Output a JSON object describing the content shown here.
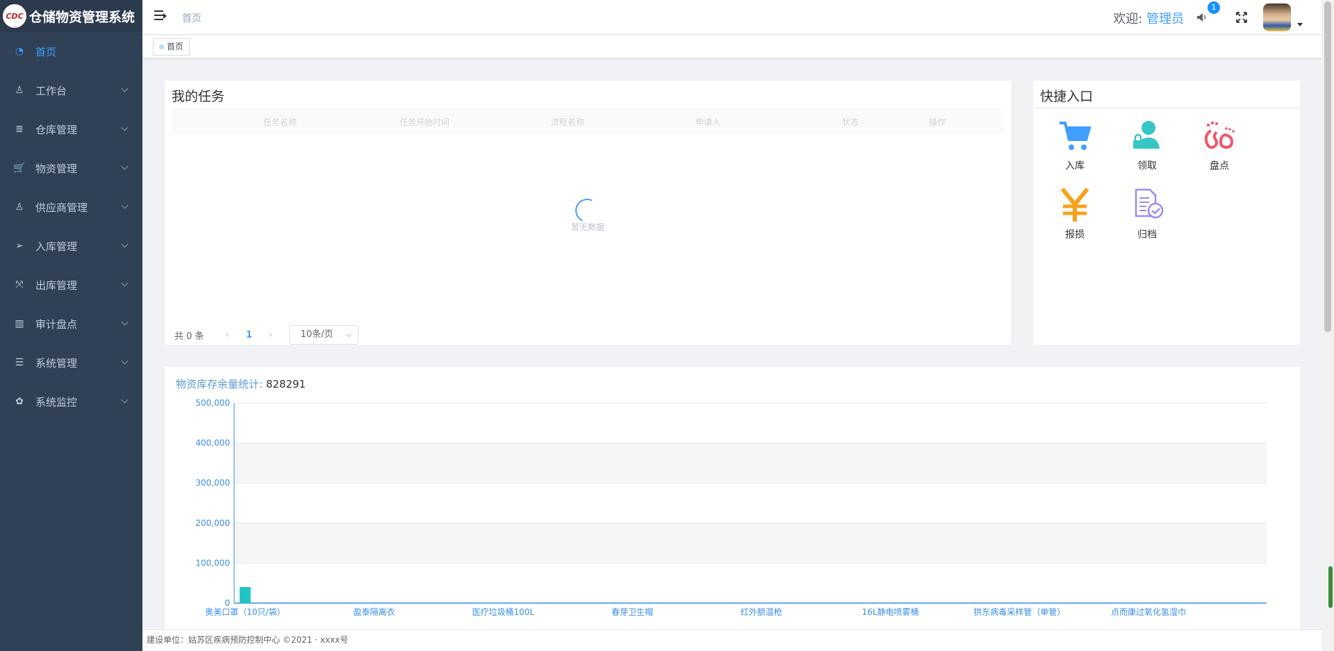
{
  "app": {
    "logo_text": "CDC",
    "title": "仓储物资管理系统"
  },
  "sidebar": {
    "items": [
      {
        "label": "首页",
        "icon": "dashboard-icon",
        "active": true
      },
      {
        "label": "工作台",
        "icon": "user-desk-icon"
      },
      {
        "label": "仓库管理",
        "icon": "database-icon"
      },
      {
        "label": "物资管理",
        "icon": "cart-icon"
      },
      {
        "label": "供应商管理",
        "icon": "supplier-icon"
      },
      {
        "label": "入库管理",
        "icon": "send-icon"
      },
      {
        "label": "出库管理",
        "icon": "expand-icon"
      },
      {
        "label": "审计盘点",
        "icon": "book-icon"
      },
      {
        "label": "系统管理",
        "icon": "list-icon"
      },
      {
        "label": "系统监控",
        "icon": "gear-icon"
      }
    ]
  },
  "navbar": {
    "breadcrumb": "首页",
    "welcome_prefix": "欢迎:",
    "username": "管理员",
    "notification_count": "1"
  },
  "tags": {
    "home": "首页"
  },
  "tasks": {
    "title": "我的任务",
    "columns": [
      "任务名称",
      "任务开始时间",
      "流程名称",
      "申请人",
      "状态",
      "操作"
    ],
    "empty_text": "暂无数据",
    "pager": {
      "total": "共 0 条",
      "current_page": "1",
      "page_size": "10条/页"
    }
  },
  "quick": {
    "title": "快捷入口",
    "items": [
      {
        "label": "入库",
        "icon": "cart-icon",
        "color": "#409eff"
      },
      {
        "label": "领取",
        "icon": "person-lock-icon",
        "color": "#36c6c6"
      },
      {
        "label": "盘点",
        "icon": "footprint-icon",
        "color": "#f0566c"
      },
      {
        "label": "报损",
        "icon": "yen-icon",
        "color": "#f7a21b"
      },
      {
        "label": "归档",
        "icon": "document-check-icon",
        "color": "#9a8cf0"
      }
    ]
  },
  "stats": {
    "title": "物资库存余量统计:",
    "total": "828291"
  },
  "chart_data": {
    "type": "bar",
    "title": "物资库存余量统计: 828291",
    "xlabel": "",
    "ylabel": "",
    "ylim": [
      0,
      500000
    ],
    "y_ticks": [
      "0",
      "100,000",
      "200,000",
      "300,000",
      "400,000",
      "500,000"
    ],
    "grid": true,
    "bar_color": "#1fc5c5",
    "x_tick_labels": [
      "奥美口罩（10只/袋）",
      "盈泰隔离衣",
      "医疗垃圾桶100L",
      "春芽卫生帽",
      "红外额温枪",
      "16L静电喷雾桶",
      "拱东病毒采样管（单管）",
      "点而康过氧化氢湿巾"
    ],
    "values": [
      40000,
      0,
      0,
      0,
      0,
      0,
      0,
      0,
      0,
      0,
      0,
      0,
      0,
      0,
      0,
      0,
      0,
      0,
      0,
      0,
      0,
      0,
      0,
      0,
      0,
      0,
      0,
      0,
      0,
      0,
      0,
      0,
      0,
      0,
      0,
      0,
      0,
      0,
      0,
      0,
      0,
      0,
      0,
      0,
      0,
      0,
      0
    ]
  },
  "footer": {
    "text": "建设单位：姑苏区疾病预防控制中心 ©2021 · xxxx号"
  }
}
